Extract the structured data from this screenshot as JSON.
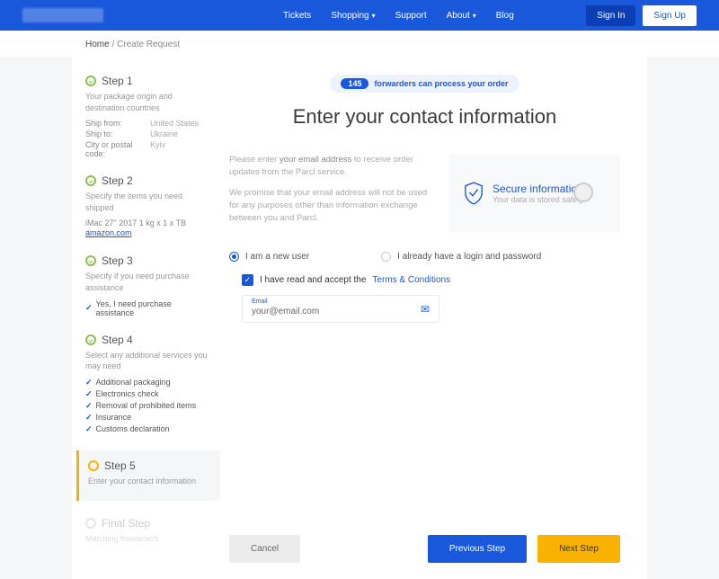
{
  "nav": {
    "tickets": "Tickets",
    "shopping": "Shopping",
    "support": "Support",
    "about": "About",
    "blog": "Blog"
  },
  "auth": {
    "signin": "Sign In",
    "signup": "Sign Up"
  },
  "breadcrumb": {
    "home": "Home",
    "sep": "/",
    "current": "Create Request"
  },
  "steps": {
    "s1": {
      "title": "Step 1",
      "desc": "Your package origin and destination countries",
      "ship_from_k": "Ship from:",
      "ship_from_v": "United States",
      "ship_to_k": "Ship to:",
      "ship_to_v": "Ukraine",
      "city_k": "City or postal code:",
      "city_v": "Kyiv"
    },
    "s2": {
      "title": "Step 2",
      "desc": "Specify the items you need shipped",
      "item": "iMac 27\" 2017   1 kg x 1 x TB",
      "link": "amazon.com"
    },
    "s3": {
      "title": "Step 3",
      "desc": "Specify if you need purchase assistance",
      "opt": "Yes, I need purchase assistance"
    },
    "s4": {
      "title": "Step 4",
      "desc": "Select any additional services you may need",
      "o1": "Additional packaging",
      "o2": "Electronics check",
      "o3": "Removal of prohibited items",
      "o4": "Insurance",
      "o5": "Customs declaration"
    },
    "s5": {
      "title": "Step 5",
      "desc": "Enter your contact information"
    },
    "final": {
      "title": "Final Step",
      "desc": "Matching forwarders"
    }
  },
  "pill": {
    "count": "145",
    "text": "forwarders can process your order"
  },
  "heading": "Enter your contact information",
  "intro1a": "Please enter ",
  "intro1b": "your email address",
  "intro1c": " to receive order updates from the Parcl service.",
  "intro2": "We promise that your email address will not be used for any purposes other than information exchange between you and Parcl.",
  "secure": {
    "title": "Secure information",
    "desc": "Your data is stored safely."
  },
  "radios": {
    "new": "I am a new user",
    "existing": "I already have a login and password"
  },
  "terms": {
    "pre": "I have read and accept the ",
    "link": "Terms & Conditions"
  },
  "email": {
    "label": "Email",
    "value": "your@email.com"
  },
  "buttons": {
    "cancel": "Cancel",
    "prev": "Previous Step",
    "next": "Next Step"
  }
}
